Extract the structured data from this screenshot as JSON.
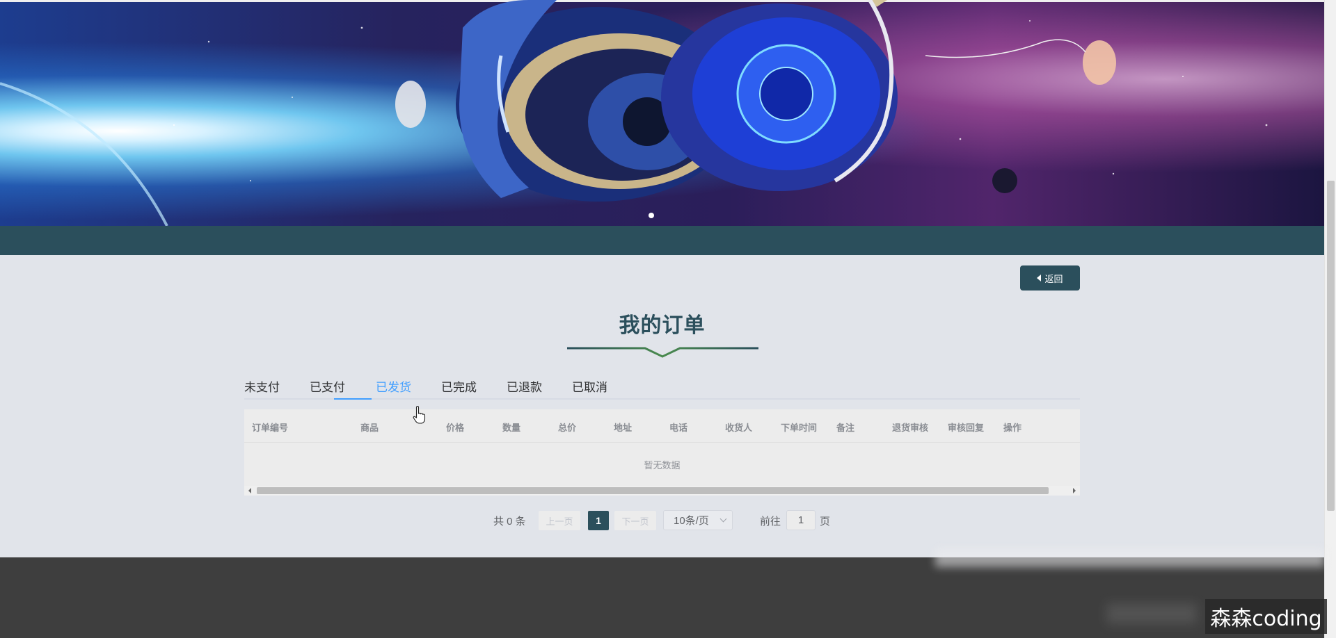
{
  "banner": {
    "slide_count": 1,
    "active_slide": 1
  },
  "header": {
    "back_label": "返回"
  },
  "page": {
    "title": "我的订单"
  },
  "tabs": [
    {
      "label": "未支付",
      "active": false
    },
    {
      "label": "已支付",
      "active": false
    },
    {
      "label": "已发货",
      "active": true
    },
    {
      "label": "已完成",
      "active": false
    },
    {
      "label": "已退款",
      "active": false
    },
    {
      "label": "已取消",
      "active": false
    }
  ],
  "table": {
    "columns": [
      "订单编号",
      "商品",
      "价格",
      "数量",
      "总价",
      "地址",
      "电话",
      "收货人",
      "下单时间",
      "备注",
      "退货审核",
      "审核回复",
      "操作"
    ],
    "rows": [],
    "empty_text": "暂无数据"
  },
  "pagination": {
    "total": "共 0 条",
    "prev_label": "上一页",
    "current_page": "1",
    "next_label": "下一页",
    "page_size": "10条/页",
    "goto_label": "前往",
    "goto_value": "1",
    "page_unit": "页"
  },
  "watermark": "森森coding",
  "colors": {
    "primary": "#2b4f5c",
    "active_tab": "#409eff",
    "page_bg": "#e1e4ea",
    "footer": "#3e3e3e"
  }
}
